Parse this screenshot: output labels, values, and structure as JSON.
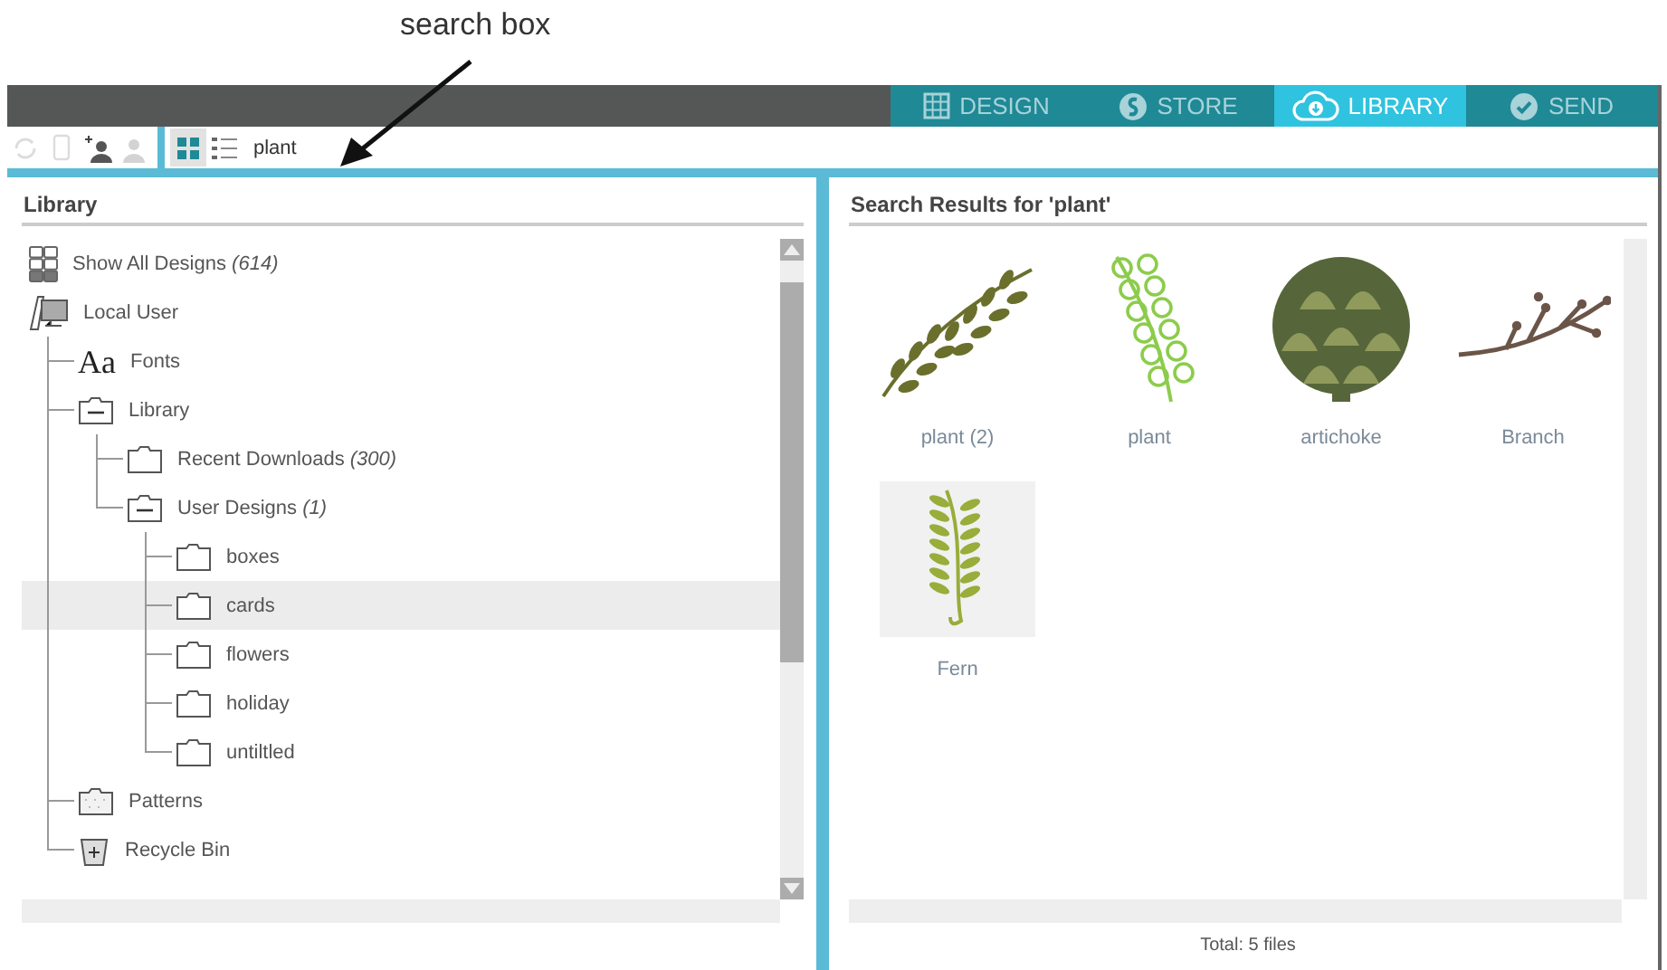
{
  "annotation": {
    "label": "search box"
  },
  "tabs": [
    {
      "label": "DESIGN",
      "selected": false
    },
    {
      "label": "STORE",
      "selected": false
    },
    {
      "label": "LIBRARY",
      "selected": true
    },
    {
      "label": "SEND",
      "selected": false
    }
  ],
  "toolbar": {
    "actions": [
      {
        "disabled": true
      },
      {
        "disabled": true
      },
      {
        "disabled": false
      },
      {
        "disabled": true
      }
    ],
    "views": [
      {
        "selected": true
      },
      {
        "selected": false
      }
    ],
    "search": {
      "value": "plant"
    }
  },
  "library": {
    "title": "Library",
    "tree": [
      {
        "kind": "grid",
        "label": "Show All Designs *(614)*",
        "selected": false
      },
      {
        "kind": "computer",
        "label": "Local User",
        "selected": false,
        "children": [
          {
            "kind": "font",
            "glyph": "Aa",
            "label": "Fonts",
            "selected": false
          },
          {
            "kind": "folder",
            "label": "Library",
            "expanded": true,
            "selected": false,
            "children": [
              {
                "kind": "folder",
                "label": "Recent Downloads *(300)*",
                "expanded": false,
                "selected": false
              },
              {
                "kind": "folder",
                "label": "User Designs *(1)*",
                "expanded": true,
                "selected": false,
                "children": [
                  {
                    "kind": "folder",
                    "label": "boxes",
                    "expanded": false,
                    "selected": false
                  },
                  {
                    "kind": "folder",
                    "label": "cards",
                    "expanded": false,
                    "selected": true
                  },
                  {
                    "kind": "folder",
                    "label": "flowers",
                    "expanded": false,
                    "selected": false
                  },
                  {
                    "kind": "folder",
                    "label": "holiday",
                    "expanded": false,
                    "selected": false
                  },
                  {
                    "kind": "folder",
                    "label": "untiltled",
                    "expanded": false,
                    "selected": false
                  }
                ]
              }
            ]
          },
          {
            "kind": "patterns",
            "label": "Patterns",
            "selected": false
          },
          {
            "kind": "trash",
            "label": "Recycle Bin",
            "selected": false
          }
        ]
      }
    ]
  },
  "results": {
    "title": "Search Results for 'plant'",
    "items": [
      {
        "kind": "leafy-branch",
        "name": "plant (2)",
        "selected": false
      },
      {
        "kind": "loop-fern",
        "name": "plant",
        "selected": false
      },
      {
        "kind": "artichoke",
        "name": "artichoke",
        "selected": false
      },
      {
        "kind": "twig",
        "name": "Branch",
        "selected": false
      },
      {
        "kind": "fern",
        "name": "Fern",
        "selected": true
      }
    ],
    "status": "Total: 5 files"
  }
}
